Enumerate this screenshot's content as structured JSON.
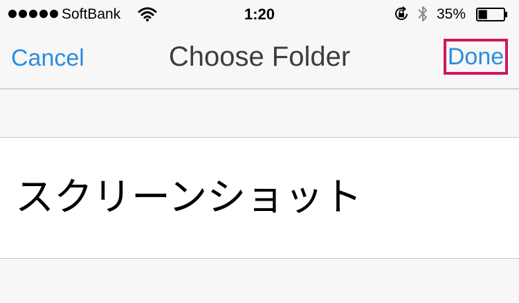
{
  "status_bar": {
    "carrier": "SoftBank",
    "time": "1:20",
    "battery_percent": "35%",
    "battery_level": 0.35,
    "signal_bars": 5,
    "icons": [
      "wifi-icon",
      "orientation-lock-icon",
      "bluetooth-icon",
      "battery-icon"
    ]
  },
  "nav": {
    "cancel_label": "Cancel",
    "title": "Choose Folder",
    "done_label": "Done"
  },
  "folders": [
    {
      "label": "スクリーンショット"
    }
  ],
  "colors": {
    "accent": "#2b8de0",
    "highlight_box": "#d1175f",
    "background": "#f7f7f7",
    "row_background": "#ffffff"
  }
}
